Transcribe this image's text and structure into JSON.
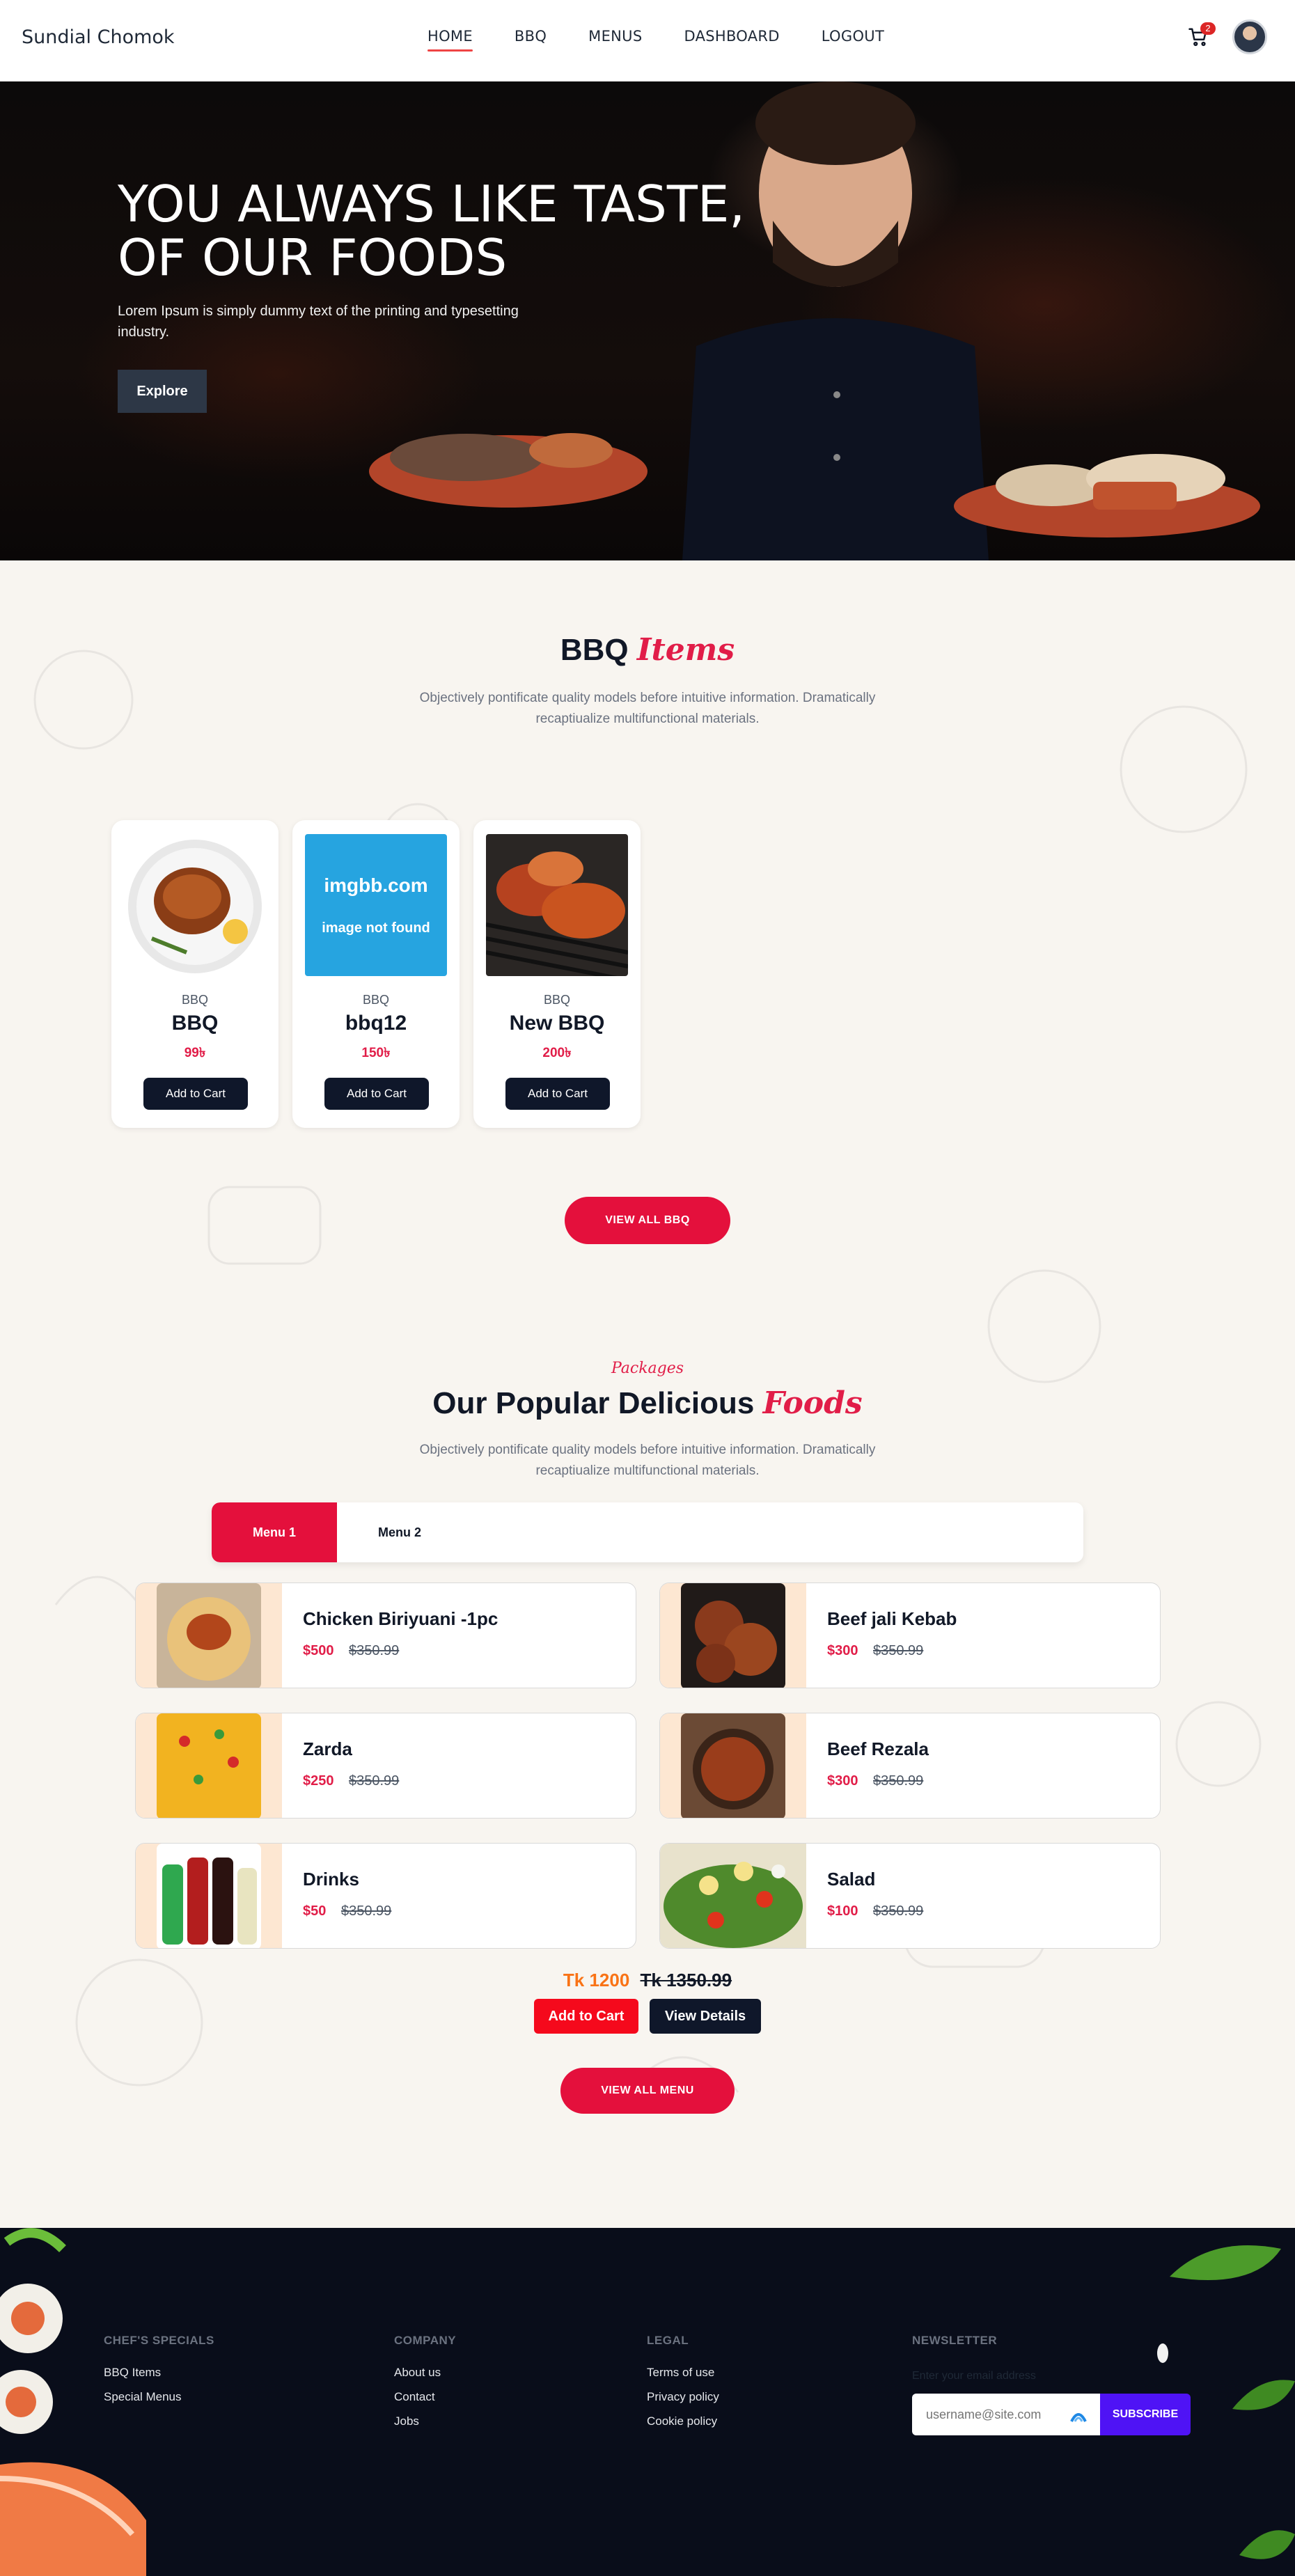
{
  "navbar": {
    "brand": "Sundial Chomok",
    "links": [
      "HOME",
      "BBQ",
      "MENUS",
      "DASHBOARD",
      "LOGOUT"
    ],
    "cart_count": "2"
  },
  "hero": {
    "title_line1": "YOU ALWAYS LIKE TASTE,",
    "title_line2": "OF OUR FOODS",
    "subtitle": "Lorem Ipsum is simply dummy text of the printing and typesetting industry.",
    "button": "Explore"
  },
  "bbq": {
    "title_main": "BBQ",
    "title_accent": "Items",
    "description": "Objectively pontificate quality models before intuitive information. Dramatically recaptiualize multifunctional materials.",
    "cards": [
      {
        "category": "BBQ",
        "name": "BBQ",
        "price": "99৳",
        "button": "Add to Cart"
      },
      {
        "category": "BBQ",
        "name": "bbq12",
        "price": "150৳",
        "button": "Add to Cart",
        "placeholder_title": "imgbb.com",
        "placeholder_sub": "image not found"
      },
      {
        "category": "BBQ",
        "name": "New BBQ",
        "price": "200৳",
        "button": "Add to Cart"
      }
    ],
    "view_all": "VIEW ALL BBQ"
  },
  "packages": {
    "kicker": "Packages",
    "title_main": "Our Popular Delicious",
    "title_accent": "Foods",
    "description": "Objectively pontificate quality models before intuitive information. Dramatically recaptiualize multifunctional materials.",
    "tabs": [
      "Menu 1",
      "Menu 2"
    ],
    "items": [
      {
        "name": "Chicken Biriyuani -1pc",
        "price": "$500",
        "old_price": "$350.99"
      },
      {
        "name": "Beef jali Kebab",
        "price": "$300",
        "old_price": "$350.99"
      },
      {
        "name": "Zarda",
        "price": "$250",
        "old_price": "$350.99"
      },
      {
        "name": "Beef Rezala",
        "price": "$300",
        "old_price": "$350.99"
      },
      {
        "name": "Drinks",
        "price": "$50",
        "old_price": "$350.99"
      },
      {
        "name": "Salad",
        "price": "$100",
        "old_price": "$350.99"
      }
    ],
    "total_new": "Tk 1200",
    "total_old": "Tk 1350.99",
    "add_button": "Add to Cart",
    "details_button": "View Details",
    "view_all": "VIEW ALL MENU"
  },
  "footer": {
    "col1": {
      "heading": "CHEF'S SPECIALS",
      "links": [
        "BBQ Items",
        "Special Menus"
      ]
    },
    "col2": {
      "heading": "COMPANY",
      "links": [
        "About us",
        "Contact",
        "Jobs"
      ]
    },
    "col3": {
      "heading": "LEGAL",
      "links": [
        "Terms of use",
        "Privacy policy",
        "Cookie policy"
      ]
    },
    "newsletter": {
      "heading": "NEWSLETTER",
      "label": "Enter your email address",
      "placeholder": "username@site.com",
      "button": "SUBSCRIBE"
    }
  },
  "colors": {
    "accent": "#e4103c",
    "dark": "#0f172a",
    "footer": "#090d1a",
    "subscribe": "#4f13f5"
  }
}
